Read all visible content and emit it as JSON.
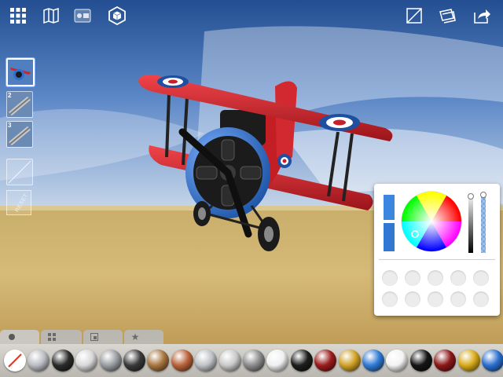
{
  "toolbar": {
    "left": [
      "grid-icon",
      "map-icon",
      "viewer-icon",
      "cube-icon"
    ],
    "right": [
      "resize-icon",
      "layers-icon",
      "share-icon"
    ]
  },
  "parts": [
    {
      "num": "",
      "icon": "plane-thumbnail-icon"
    },
    {
      "num": "2",
      "icon": "strut-thumbnail-icon"
    },
    {
      "num": "3",
      "icon": "strut-thumbnail-icon"
    }
  ],
  "reset_label": "RESET",
  "colors": {
    "accent": "#4a8fe0",
    "plane_red": "#c8202a",
    "plane_blue": "#3a78d0"
  },
  "materials": [
    {
      "name": "none",
      "color": "#ffffff"
    },
    {
      "name": "chrome",
      "color": "#b9bcc2"
    },
    {
      "name": "black-chrome",
      "color": "#2b2b2b"
    },
    {
      "name": "silver",
      "color": "#d8d8d8"
    },
    {
      "name": "steel",
      "color": "#9a9da2"
    },
    {
      "name": "dark-steel",
      "color": "#3a3a3a"
    },
    {
      "name": "bronze",
      "color": "#a8753f"
    },
    {
      "name": "copper",
      "color": "#b8623a"
    },
    {
      "name": "light-steel",
      "color": "#bfc2c6"
    },
    {
      "name": "light-gray",
      "color": "#c9c9c9"
    },
    {
      "name": "gray",
      "color": "#8c8c8c"
    },
    {
      "name": "white",
      "color": "#efefef"
    },
    {
      "name": "black",
      "color": "#1d1d1d"
    },
    {
      "name": "red",
      "color": "#9b1c1c"
    },
    {
      "name": "gold",
      "color": "#d1a128"
    },
    {
      "name": "blue",
      "color": "#2f7ad6"
    },
    {
      "name": "pearl",
      "color": "#f3f3f3"
    },
    {
      "name": "gloss-black",
      "color": "#151515"
    },
    {
      "name": "dark-red",
      "color": "#8c1818"
    },
    {
      "name": "yellow",
      "color": "#d8aa1a"
    },
    {
      "name": "deep-blue",
      "color": "#2a6fd0"
    }
  ]
}
